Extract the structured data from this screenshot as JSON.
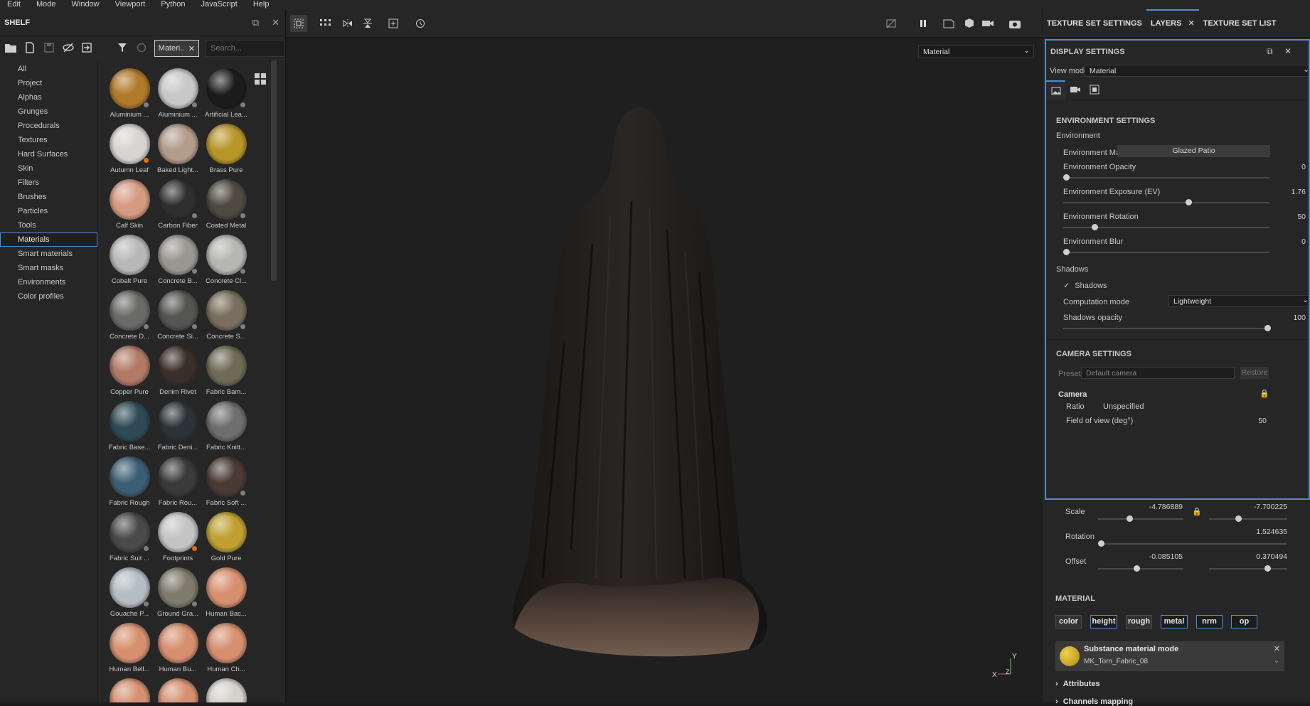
{
  "menu": [
    "Edit",
    "Mode",
    "Window",
    "Viewport",
    "Python",
    "JavaScript",
    "Help"
  ],
  "shelf": {
    "title": "SHELF",
    "filter_chip": "Materi..",
    "search_placeholder": "Search...",
    "categories": [
      "All",
      "Project",
      "Alphas",
      "Grunges",
      "Procedurals",
      "Textures",
      "Hard Surfaces",
      "Skin",
      "Filters",
      "Brushes",
      "Particles",
      "Tools",
      "Materials",
      "Smart materials",
      "Smart masks",
      "Environments",
      "Color profiles"
    ],
    "active_category": "Materials",
    "materials": [
      {
        "label": "Aluminium ...",
        "color": "#b07a2a",
        "dot": "gray"
      },
      {
        "label": "Aluminium ...",
        "color": "#c8c8c8",
        "dot": "gray"
      },
      {
        "label": "Artificial Lea...",
        "color": "#1c1c1c",
        "dot": "gray"
      },
      {
        "label": "Autumn Leaf",
        "color": "#d8d4d2",
        "dot": "orange"
      },
      {
        "label": "Baked Light...",
        "color": "#b39c8c",
        "dot": "none"
      },
      {
        "label": "Brass Pure",
        "color": "#b8962a",
        "dot": "none"
      },
      {
        "label": "Calf Skin",
        "color": "#d69a82",
        "dot": "none"
      },
      {
        "label": "Carbon Fiber",
        "color": "#2e2e2e",
        "dot": "gray"
      },
      {
        "label": "Coated Metal",
        "color": "#4e4a40",
        "dot": "gray"
      },
      {
        "label": "Cobalt Pure",
        "color": "#b8b8b8",
        "dot": "none"
      },
      {
        "label": "Concrete B...",
        "color": "#9a9690",
        "dot": "gray"
      },
      {
        "label": "Concrete Cl...",
        "color": "#b6b6b4",
        "dot": "gray"
      },
      {
        "label": "Concrete D...",
        "color": "#6a6a68",
        "dot": "gray"
      },
      {
        "label": "Concrete Si...",
        "color": "#555553",
        "dot": "gray"
      },
      {
        "label": "Concrete S...",
        "color": "#7a6e5e",
        "dot": "gray"
      },
      {
        "label": "Copper Pure",
        "color": "#b07a66",
        "dot": "none"
      },
      {
        "label": "Denim Rivet",
        "color": "#3a2e28",
        "dot": "none"
      },
      {
        "label": "Fabric Bam...",
        "color": "#6e6a56",
        "dot": "none"
      },
      {
        "label": "Fabric Base...",
        "color": "#2e4a56",
        "dot": "none"
      },
      {
        "label": "Fabric Deni...",
        "color": "#2c3236",
        "dot": "none"
      },
      {
        "label": "Fabric Knitt...",
        "color": "#6e6e6e",
        "dot": "none"
      },
      {
        "label": "Fabric Rough",
        "color": "#3c5e74",
        "dot": "none"
      },
      {
        "label": "Fabric Rou...",
        "color": "#3a3a3a",
        "dot": "none"
      },
      {
        "label": "Fabric Soft ...",
        "color": "#4a3a34",
        "dot": "gray"
      },
      {
        "label": "Fabric Suit ...",
        "color": "#4a4a4a",
        "dot": "gray"
      },
      {
        "label": "Footprints",
        "color": "#c4c4c4",
        "dot": "orange"
      },
      {
        "label": "Gold Pure",
        "color": "#c0a030",
        "dot": "none"
      },
      {
        "label": "Gouache P...",
        "color": "#b4bcc4",
        "dot": "gray"
      },
      {
        "label": "Ground Gra...",
        "color": "#7e7a6c",
        "dot": "gray"
      },
      {
        "label": "Human Bac...",
        "color": "#d69070",
        "dot": "none"
      },
      {
        "label": "Human Bell...",
        "color": "#d69070",
        "dot": "none"
      },
      {
        "label": "Human Bu...",
        "color": "#d69070",
        "dot": "none"
      },
      {
        "label": "Human Ch...",
        "color": "#d69070",
        "dot": "none"
      },
      {
        "label": "",
        "color": "#d69070",
        "dot": "none"
      },
      {
        "label": "",
        "color": "#d69070",
        "dot": "none"
      },
      {
        "label": "",
        "color": "#d4d0cc",
        "dot": "none"
      }
    ]
  },
  "viewport": {
    "view_select": "Material"
  },
  "right": {
    "tabs": [
      "TEXTURE SET SETTINGS",
      "LAYERS",
      "TEXTURE SET LIST"
    ],
    "active_tab": "LAYERS",
    "display": {
      "title": "DISPLAY SETTINGS",
      "view_mode_label": "View mode",
      "view_mode_value": "Material",
      "env_header": "ENVIRONMENT SETTINGS",
      "env_group": "Environment",
      "env_map_label": "Environment Map",
      "env_map_value": "Glazed Patio",
      "sliders": [
        {
          "label": "Environment Opacity",
          "value": "0",
          "fraction": 0.0
        },
        {
          "label": "Environment Exposure (EV)",
          "value": "1.76",
          "fraction": 0.6
        },
        {
          "label": "Environment Rotation",
          "value": "50",
          "fraction": 0.14
        },
        {
          "label": "Environment Blur",
          "value": "0",
          "fraction": 0.0
        }
      ],
      "shadows_group": "Shadows",
      "shadows_check": "Shadows",
      "computation_label": "Computation mode",
      "computation_value": "Lightweight",
      "shadow_opacity_label": "Shadows opacity",
      "shadow_opacity_value": "100",
      "shadow_opacity_fraction": 1.0,
      "camera_header": "CAMERA SETTINGS",
      "preset_label": "Preset",
      "preset_value": "Default camera",
      "restore_label": "Restore",
      "camera_group": "Camera",
      "ratio_label": "Ratio",
      "ratio_value": "Unspecified",
      "fov_label": "Field of view (deg°)",
      "fov_value": "50"
    },
    "transform": {
      "scale_label": "Scale",
      "scale_x": "-4.786889",
      "scale_y": "-7.700225",
      "rotation_label": "Rotation",
      "rotation_value": "1.524635",
      "offset_label": "Offset",
      "offset_x": "-0.085105",
      "offset_y": "0.370494"
    },
    "material": {
      "header": "MATERIAL",
      "channels": [
        {
          "label": "color",
          "on": false
        },
        {
          "label": "height",
          "on": true
        },
        {
          "label": "rough",
          "on": false
        },
        {
          "label": "metal",
          "on": true
        },
        {
          "label": "nrm",
          "on": true
        },
        {
          "label": "op",
          "on": true
        }
      ],
      "mode_title": "Substance material mode",
      "mode_material": "MK_Torn_Fabric_08",
      "attributes_label": "Attributes",
      "channels_mapping_label": "Channels mapping"
    },
    "axes": {
      "x": "X",
      "y": "Y",
      "z": "Z"
    }
  }
}
